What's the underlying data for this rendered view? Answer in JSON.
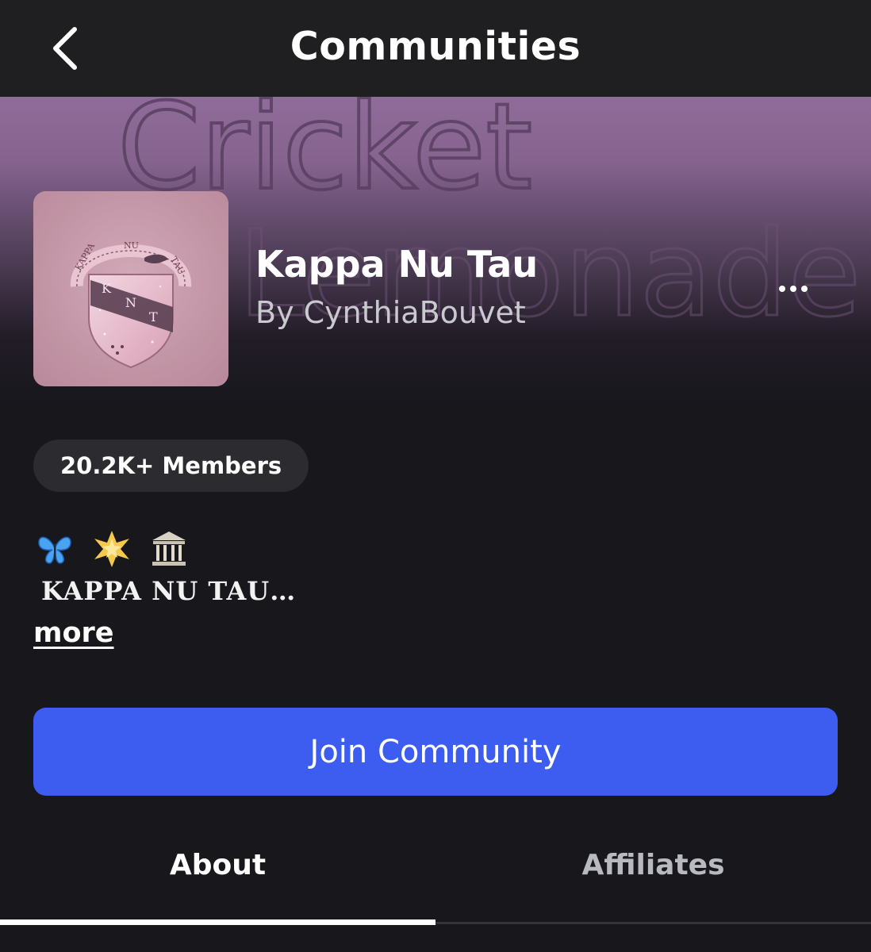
{
  "header": {
    "title": "Communities",
    "back_icon": "chevron-left-icon"
  },
  "banner": {
    "watermark_line1": "Cricket",
    "watermark_line2": "Lemonade",
    "colors": {
      "top": "#8f6c99",
      "bottom": "#17171c"
    }
  },
  "community": {
    "name": "Kappa Nu Tau",
    "author": "By CynthiaBouvet",
    "logo": {
      "arc_letters": [
        "KAPPA",
        "NU",
        "TAU"
      ],
      "shield_letters": [
        "K",
        "N",
        "T"
      ]
    },
    "more_icon": "ellipsis-icon",
    "members": "20.2K+ Members",
    "emojis": [
      "butterfly-icon",
      "glowing-star-icon",
      "classical-building-icon"
    ],
    "description": "KAPPA NU TAU…",
    "more_link": "more"
  },
  "actions": {
    "join_label": "Join Community",
    "accent": "#3d5cf0"
  },
  "tabs": [
    {
      "label": "About",
      "active": true
    },
    {
      "label": "Affiliates",
      "active": false
    }
  ]
}
